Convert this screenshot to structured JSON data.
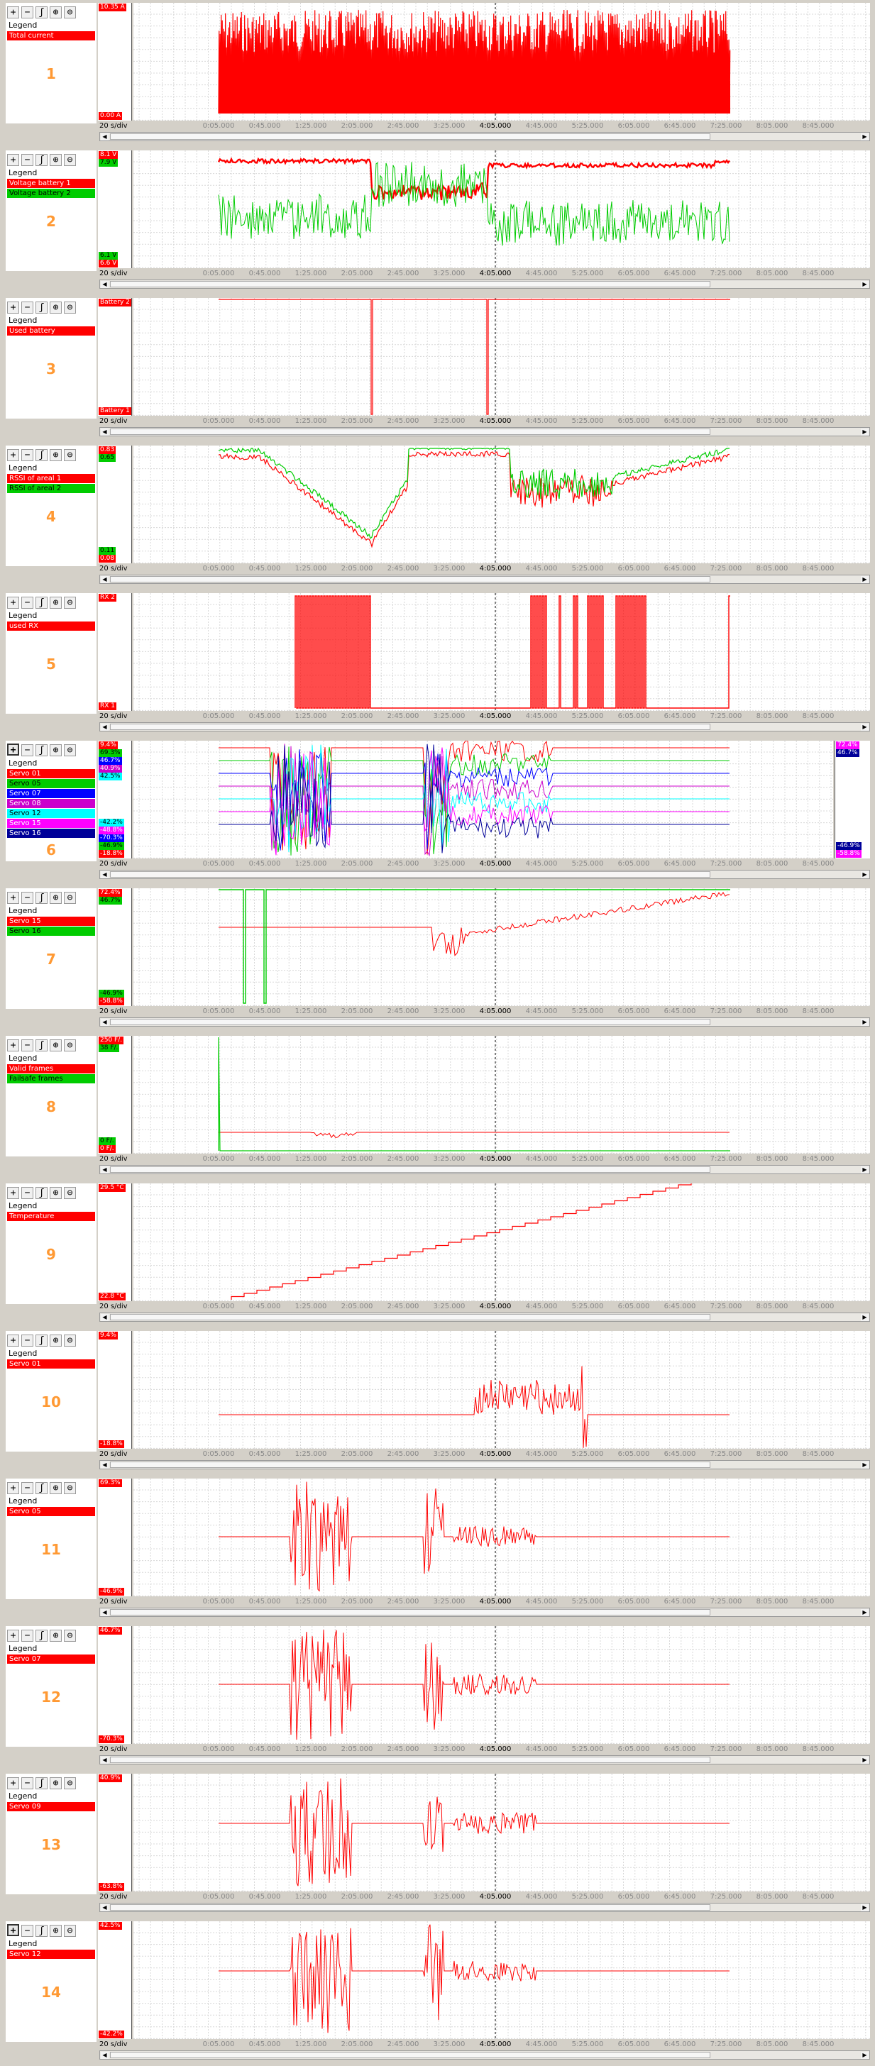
{
  "toolbar": {
    "icons": [
      "plus-icon",
      "minus-icon",
      "wrench-icon",
      "zoom-in-icon",
      "zoom-out-icon"
    ],
    "glyphs": [
      "+",
      "−",
      "ʃ",
      "⊕",
      "⊖"
    ]
  },
  "legend_title": "Legend",
  "time_base": "20 s/div",
  "ticks": [
    "0:05.000",
    "0:45.000",
    "1:25.000",
    "2:05.000",
    "2:45.000",
    "3:25.000",
    "4:05.000",
    "4:45.000",
    "5:25.000",
    "6:05.000",
    "6:45.000",
    "7:25.000",
    "8:05.000",
    "8:45.000"
  ],
  "cursor_tick": "4:05.000",
  "chart_data": [
    {
      "id": "1",
      "type": "line",
      "series": [
        {
          "name": "Total current",
          "color": "#ff0000",
          "pattern": "dense"
        }
      ],
      "labels": {
        "top": [
          {
            "text": "10.35 A",
            "color": "#ff0000"
          }
        ],
        "bottom": [
          {
            "text": "0.00 A",
            "color": "#ff0000"
          }
        ]
      },
      "ylim": [
        0,
        10.35
      ],
      "xlim": [
        "0:05.000",
        "7:25.000"
      ]
    },
    {
      "id": "2",
      "type": "line",
      "series": [
        {
          "name": "Voltage battery 1",
          "color": "#ff0000",
          "pattern": "volt1"
        },
        {
          "name": "Voltage battery 2",
          "color": "#00cc00",
          "pattern": "volt2"
        }
      ],
      "labels": {
        "top": [
          {
            "text": "8.1 V",
            "color": "#ff0000"
          },
          {
            "text": "7.9 V",
            "color": "#00cc00"
          }
        ],
        "bottom": [
          {
            "text": "6.1 V",
            "color": "#00cc00"
          },
          {
            "text": "6.6 V",
            "color": "#ff0000"
          }
        ]
      }
    },
    {
      "id": "3",
      "type": "line",
      "series": [
        {
          "name": "Used battery",
          "color": "#ff0000",
          "pattern": "battery"
        }
      ],
      "labels": {
        "top": [
          {
            "text": "Battery 2",
            "color": "#ff0000"
          }
        ],
        "bottom": [
          {
            "text": "Battery 1",
            "color": "#ff0000"
          }
        ]
      }
    },
    {
      "id": "4",
      "type": "line",
      "series": [
        {
          "name": "RSSI of areal 1",
          "color": "#ff0000",
          "pattern": "rssi1"
        },
        {
          "name": "RSSI of areal 2",
          "color": "#00cc00",
          "pattern": "rssi2"
        }
      ],
      "labels": {
        "top": [
          {
            "text": "0.83",
            "color": "#ff0000"
          },
          {
            "text": "0.65",
            "color": "#00cc00"
          }
        ],
        "bottom": [
          {
            "text": "0.11",
            "color": "#00cc00"
          },
          {
            "text": "0.08",
            "color": "#ff0000"
          }
        ]
      }
    },
    {
      "id": "5",
      "type": "line",
      "series": [
        {
          "name": "used RX",
          "color": "#ff0000",
          "pattern": "rx"
        }
      ],
      "labels": {
        "top": [
          {
            "text": "RX 2",
            "color": "#ff0000"
          }
        ],
        "bottom": [
          {
            "text": "RX 1",
            "color": "#ff0000"
          }
        ]
      }
    },
    {
      "id": "6",
      "type": "line",
      "series": [
        {
          "name": "Servo 01",
          "color": "#ff0000",
          "pattern": "s6a"
        },
        {
          "name": "Servo 05",
          "color": "#00cc00",
          "pattern": "s6b"
        },
        {
          "name": "Servo 07",
          "color": "#0000ff",
          "pattern": "s6c"
        },
        {
          "name": "Servo 08",
          "color": "#cc00cc",
          "pattern": "s6d"
        },
        {
          "name": "Servo 12",
          "color": "#00ffff",
          "pattern": "s6e"
        },
        {
          "name": "Servo 15",
          "color": "#ff00ff",
          "pattern": "s6f"
        },
        {
          "name": "Servo 16",
          "color": "#000099",
          "pattern": "s6g"
        }
      ],
      "labels": {
        "top": [
          {
            "text": "9.4%",
            "color": "#ff0000"
          },
          {
            "text": "69.3%",
            "color": "#00cc00"
          },
          {
            "text": "46.7%",
            "color": "#0000ff"
          },
          {
            "text": "40.9%",
            "color": "#cc00cc"
          },
          {
            "text": "42.5%",
            "color": "#00ffff"
          }
        ],
        "bottom": [
          {
            "text": "-42.2%",
            "color": "#00ffff"
          },
          {
            "text": "-48.8%",
            "color": "#ff00ff"
          },
          {
            "text": "-70.3%",
            "color": "#0000ff"
          },
          {
            "text": "-46.9%",
            "color": "#00cc00"
          },
          {
            "text": "-18.8%",
            "color": "#ff0000"
          }
        ],
        "right_top": [
          {
            "text": "72.4%",
            "color": "#ff00ff"
          },
          {
            "text": "46.7%",
            "color": "#000099"
          }
        ],
        "right_bottom": [
          {
            "text": "-46.9%",
            "color": "#000099"
          },
          {
            "text": "-58.8%",
            "color": "#ff00ff"
          }
        ]
      }
    },
    {
      "id": "7",
      "type": "line",
      "series": [
        {
          "name": "Servo 15",
          "color": "#ff0000",
          "pattern": "servo15"
        },
        {
          "name": "Servo 16",
          "color": "#00cc00",
          "pattern": "servo16"
        }
      ],
      "labels": {
        "top": [
          {
            "text": "72.4%",
            "color": "#ff0000"
          },
          {
            "text": "46.7%",
            "color": "#00cc00"
          }
        ],
        "bottom": [
          {
            "text": "-46.9%",
            "color": "#00cc00"
          },
          {
            "text": "-58.8%",
            "color": "#ff0000"
          }
        ]
      }
    },
    {
      "id": "8",
      "type": "line",
      "series": [
        {
          "name": "Valid frames",
          "color": "#ff0000",
          "pattern": "valid"
        },
        {
          "name": "Failsafe frames",
          "color": "#00cc00",
          "pattern": "failsafe"
        }
      ],
      "labels": {
        "top": [
          {
            "text": "250 F/.",
            "color": "#ff0000"
          },
          {
            "text": "38 F/.",
            "color": "#00cc00"
          }
        ],
        "bottom": [
          {
            "text": "0 F/.",
            "color": "#00cc00"
          },
          {
            "text": "0 F/.",
            "color": "#ff0000"
          }
        ]
      }
    },
    {
      "id": "9",
      "type": "line",
      "series": [
        {
          "name": "Temperature",
          "color": "#ff0000",
          "pattern": "temp"
        }
      ],
      "labels": {
        "top": [
          {
            "text": "29.5 °C",
            "color": "#ff0000"
          }
        ],
        "bottom": [
          {
            "text": "22.8 °C",
            "color": "#ff0000"
          }
        ]
      },
      "ylim": [
        22.8,
        29.5
      ]
    },
    {
      "id": "10",
      "type": "line",
      "series": [
        {
          "name": "Servo 01",
          "color": "#ff0000",
          "pattern": "servo01"
        }
      ],
      "labels": {
        "top": [
          {
            "text": "9.4%",
            "color": "#ff0000"
          }
        ],
        "bottom": [
          {
            "text": "-18.8%",
            "color": "#ff0000"
          }
        ]
      }
    },
    {
      "id": "11",
      "type": "line",
      "series": [
        {
          "name": "Servo 05",
          "color": "#ff0000",
          "pattern": "servo"
        }
      ],
      "labels": {
        "top": [
          {
            "text": "69.3%",
            "color": "#ff0000"
          }
        ],
        "bottom": [
          {
            "text": "-46.9%",
            "color": "#ff0000"
          }
        ]
      }
    },
    {
      "id": "12",
      "type": "line",
      "series": [
        {
          "name": "Servo 07",
          "color": "#ff0000",
          "pattern": "servo"
        }
      ],
      "labels": {
        "top": [
          {
            "text": "46.7%",
            "color": "#ff0000"
          }
        ],
        "bottom": [
          {
            "text": "-70.3%",
            "color": "#ff0000"
          }
        ]
      }
    },
    {
      "id": "13",
      "type": "line",
      "series": [
        {
          "name": "Servo 09",
          "color": "#ff0000",
          "pattern": "servo9"
        }
      ],
      "labels": {
        "top": [
          {
            "text": "40.9%",
            "color": "#ff0000"
          }
        ],
        "bottom": [
          {
            "text": "-63.8%",
            "color": "#ff0000"
          }
        ]
      }
    },
    {
      "id": "14",
      "type": "line",
      "series": [
        {
          "name": "Servo 12",
          "color": "#ff0000",
          "pattern": "servo9"
        }
      ],
      "labels": {
        "top": [
          {
            "text": "42.5%",
            "color": "#ff0000"
          }
        ],
        "bottom": [
          {
            "text": "-42.2%",
            "color": "#ff0000"
          }
        ]
      }
    }
  ]
}
